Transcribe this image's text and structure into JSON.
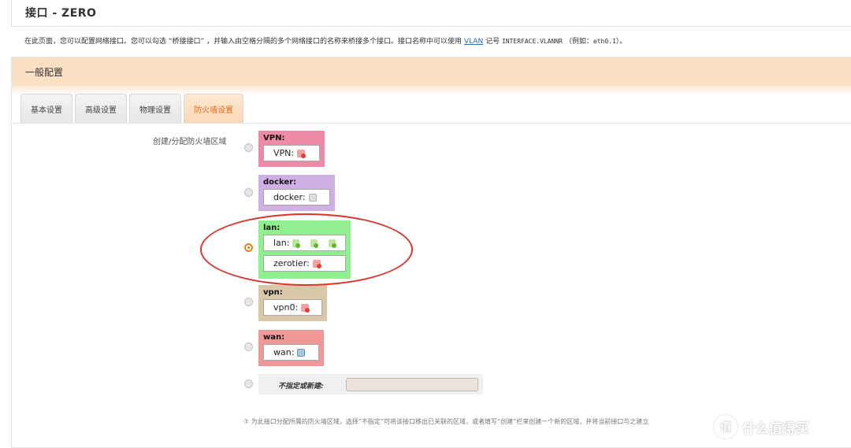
{
  "page": {
    "title": "接口 - ZERO",
    "description_before": "在此页面，您可以配置网络接口。您可以勾选 “桥接接口” ，并输入由空格分隔的多个网络接口的名称来桥接多个接口。接口名称中可以使用 ",
    "description_link": "VLAN",
    "description_mid": " 记号 ",
    "description_code": "INTERFACE.VLANNR",
    "description_after": " （例如：",
    "description_code2": "eth0.1",
    "description_end": "）。"
  },
  "section": {
    "title": "一般配置"
  },
  "tabs": [
    {
      "label": "基本设置",
      "active": false
    },
    {
      "label": "高级设置",
      "active": false
    },
    {
      "label": "物理设置",
      "active": false
    },
    {
      "label": "防火墙设置",
      "active": true
    }
  ],
  "firewall": {
    "field_label": "创建/分配防火墙区域",
    "zones": [
      {
        "name": "VPN:",
        "color": "#ee8aa6",
        "selected": false,
        "interfaces": [
          {
            "label": "VPN:",
            "icons": [
              "red"
            ]
          }
        ]
      },
      {
        "name": "docker:",
        "color": "#cfb0e4",
        "selected": false,
        "interfaces": [
          {
            "label": "docker:",
            "icons": [
              "grey"
            ]
          }
        ]
      },
      {
        "name": "lan:",
        "color": "#90f090",
        "selected": true,
        "interfaces": [
          {
            "label": "lan:",
            "icons": [
              "green",
              "green",
              "green"
            ]
          },
          {
            "label": "zerotier:",
            "icons": [
              "red"
            ]
          }
        ]
      },
      {
        "name": "vpn:",
        "color": "#d8c8a8",
        "selected": false,
        "interfaces": [
          {
            "label": "vpn0:",
            "icons": [
              "red"
            ]
          }
        ]
      },
      {
        "name": "wan:",
        "color": "#f09898",
        "selected": false,
        "interfaces": [
          {
            "label": "wan:",
            "icons": [
              "blue"
            ]
          }
        ]
      }
    ],
    "new_zone_label": "不指定或新建:",
    "new_zone_value": "",
    "help_text": "为此接口分配所属的防火墙区域，选择“不指定”可将该接口移出已关联的区域，或者填写“创建”栏来创建一个新的区域，并将当前接口与之建立"
  },
  "watermark": {
    "symbol": "值",
    "text": "什么值得买"
  }
}
